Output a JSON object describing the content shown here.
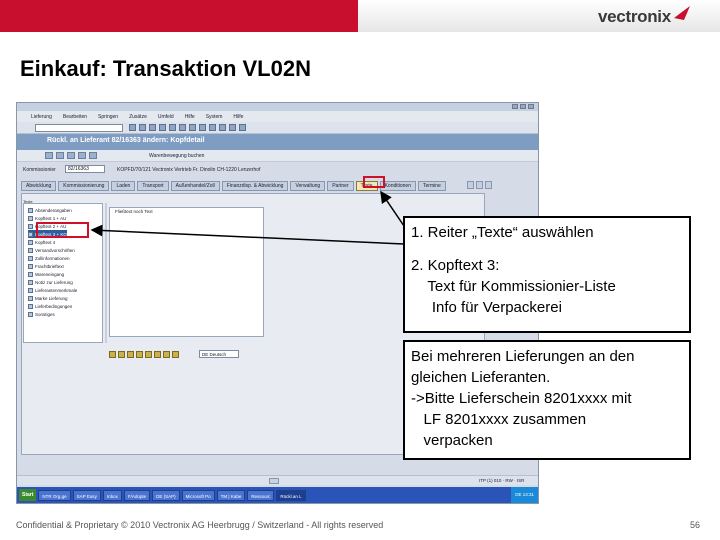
{
  "brand": {
    "logo_text": "vectronix"
  },
  "slide": {
    "title": "Einkauf: Transaktion VL02N"
  },
  "sap": {
    "menu": [
      "Lieferung",
      "Bearbeiten",
      "Springen",
      "Zusätze",
      "Umfeld",
      "Hilfe",
      "System",
      "Hilfe"
    ],
    "header_title": "Rückl. an Lieferant 82/16363 ändern: Kopfdetail",
    "appbar_text": "Warenbewegung buchen",
    "field_label": "Kommissionier",
    "field_value": "82/16363",
    "field_text": "KOPFD/70/121 Vectronix Vertrieb Fr. Dinolin CH-1220 Lenzerhof",
    "tabs": [
      "Abwicklung",
      "Kommissionierung",
      "Laden",
      "Transport",
      "Außenhandel/Zoll",
      "Finanzdisp. & Abwicklung",
      "Verwaltung",
      "Partner",
      "Texte",
      "Konditionen",
      "Termine"
    ],
    "active_tab_index": 8,
    "tree_header": "Texte",
    "tree_items": [
      "Absenderangaben",
      "Kopftext 1 + AU",
      "Kopftext 2 + AU",
      "Kopftext 3 + KO",
      "Kopftext 4",
      "Versandvorschriften",
      "Zollinformationen",
      "Frachtbrieftext",
      "Wareneingang",
      "Notiz zur Lieferung",
      "Lieferantenmerkmale",
      "Marke Lieferung",
      "Lieferbedingungen",
      "Sonstiges"
    ],
    "selected_tree_index": 3,
    "textarea_label": "Fließtext noch Text",
    "language_value": "DE Deutsch",
    "status_right": "ITP (1) 010 · RW · ISR",
    "taskbar": {
      "start": "Start",
      "items": [
        "",
        "",
        "",
        "NTR Org.ge",
        "SAP Easy",
        "Inbox",
        "F/Adopte",
        "DE (SAP)",
        "Microsoft Po",
        "TM | Kabe",
        "Ressourc",
        "Rückl.an L"
      ],
      "active_item_index": 11,
      "clock": "DE 13:31"
    }
  },
  "callouts": {
    "first": {
      "line1": "1. Reiter „Texte“ auswählen",
      "line2": "2. Kopftext 3:",
      "line3": "    Text für Kommissionier-Liste",
      "line4": "     Info für Verpackerei"
    },
    "second": {
      "line1": "Bei mehreren Lieferungen an den",
      "line2": "gleichen Lieferanten.",
      "line3": "->Bitte Lieferschein 8201xxxx mit",
      "line4": "   LF 8201xxxx zusammen",
      "line5": "   verpacken"
    }
  },
  "footer": {
    "text": "Confidential & Proprietary © 2010 Vectronix AG Heerbrugg / Switzerland - All rights reserved",
    "page": "56"
  },
  "colors": {
    "brand_red": "#c8102e",
    "highlight_red": "#d0102a",
    "sap_header_blue": "#7f9cc3"
  }
}
